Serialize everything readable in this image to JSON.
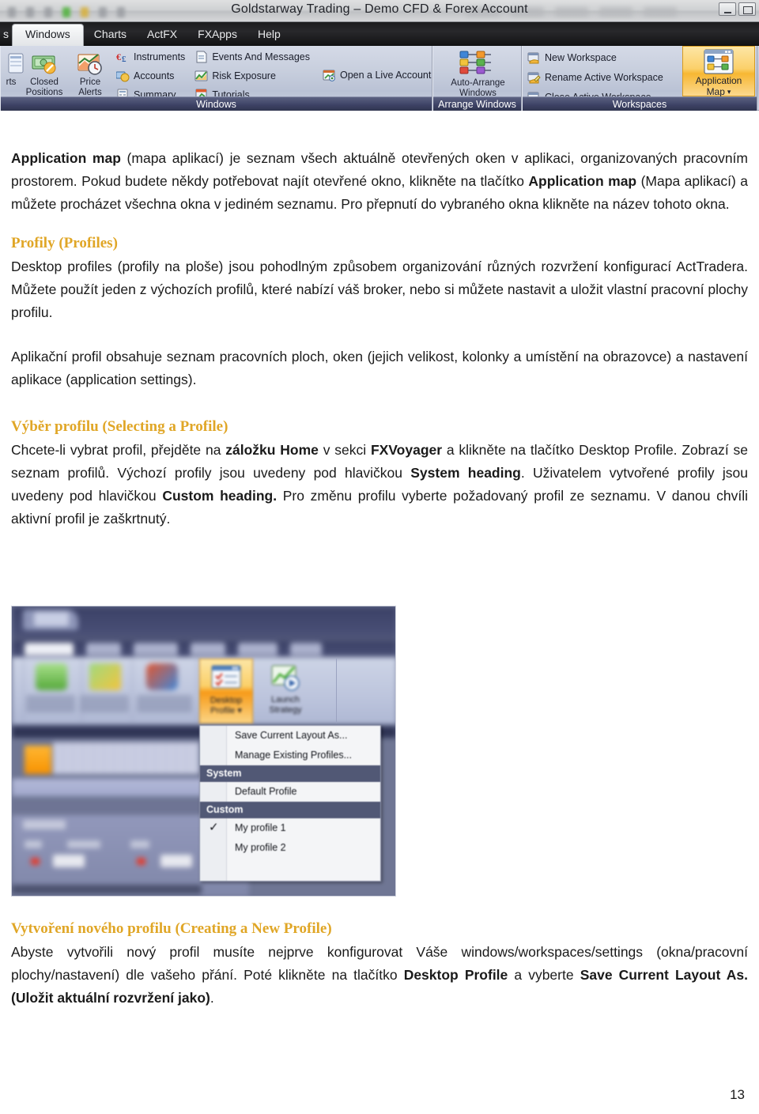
{
  "ribbon_screenshot": {
    "window_title": "Goldstarway Trading – Demo CFD & Forex Account",
    "window_buttons": [
      "minimize-button",
      "restore-button"
    ],
    "tabs": [
      {
        "label": "s",
        "active": false,
        "clipped": true
      },
      {
        "label": "Windows",
        "active": true
      },
      {
        "label": "Charts",
        "active": false
      },
      {
        "label": "ActFX",
        "active": false
      },
      {
        "label": "FXApps",
        "active": false
      },
      {
        "label": "Help",
        "active": false
      }
    ],
    "groups": [
      {
        "name": "Windows",
        "label": "Windows",
        "big_buttons": [
          {
            "line1": "rts",
            "line2": "",
            "icon": "clipped-icon"
          },
          {
            "line1": "Closed",
            "line2": "Positions",
            "icon": "money-icon"
          },
          {
            "line1": "Price",
            "line2": "Alerts",
            "icon": "price-alert-icon"
          }
        ],
        "small_items_col1": [
          {
            "label": "Instruments",
            "icon": "currency-icon"
          },
          {
            "label": "Accounts",
            "icon": "accounts-icon"
          },
          {
            "label": "Summary",
            "icon": "summary-icon"
          }
        ],
        "small_items_col2": [
          {
            "label": "Events And Messages",
            "icon": "events-icon"
          },
          {
            "label": "Risk Exposure",
            "icon": "risk-chart-icon"
          },
          {
            "label": "Tutorials",
            "icon": "tutorials-icon"
          }
        ],
        "small_items_col3": [
          {
            "label": "Open a Live Account",
            "icon": "live-account-icon"
          }
        ]
      },
      {
        "name": "Arrange Windows",
        "label": "Arrange Windows",
        "big_buttons": [
          {
            "line1": "Auto-Arrange",
            "line2": "Windows",
            "icon": "auto-arrange-icon"
          }
        ]
      },
      {
        "name": "Workspaces",
        "label": "Workspaces",
        "small_items_col1": [
          {
            "label": "New Workspace",
            "icon": "new-workspace-icon"
          },
          {
            "label": "Rename Active Workspace",
            "icon": "rename-workspace-icon"
          },
          {
            "label": "Close Active Workspace",
            "icon": "close-workspace-icon"
          }
        ],
        "highlight_button": {
          "line1": "Application",
          "line2": "Map",
          "dropdown_caret": "▾",
          "icon": "application-map-icon",
          "highlight_color": "#f7b733"
        }
      }
    ]
  },
  "document": {
    "paragraph_1": {
      "bold_1": "Application map",
      "text_1": " (mapa aplikací) je seznam všech aktuálně otevřených oken v aplikaci, organizovaných pracovním prostorem. Pokud budete někdy potřebovat najít otevřené okno, klikněte na tlačítko ",
      "bold_2": "Application map",
      "text_2": " (Mapa aplikací) a můžete procházet všechna okna v jediném seznamu. Pro přepnutí do vybraného okna klikněte na název tohoto okna."
    },
    "heading_1": "Profily (Profiles)",
    "paragraph_2": "Desktop profiles (profily na ploše) jsou pohodlným způsobem organizování různých rozvržení konfigurací ActTradera. Můžete použít jeden z výchozích profilů, které nabízí váš broker, nebo si můžete nastavit a uložit vlastní pracovní plochy profilu.",
    "paragraph_3": "Aplikační profil obsahuje seznam pracovních ploch, oken (jejich velikost, kolonky a umístění na obrazovce) a nastavení aplikace (application settings).",
    "heading_2": "Výběr profilu (Selecting a Profile)",
    "paragraph_4": {
      "text_1": "Chcete-li vybrat profil, přejděte na ",
      "bold_1": "záložku Home",
      "text_2": " v sekci ",
      "bold_2": "FXVoyager",
      "text_3": " a klikněte na tlačítko Desktop Profile. Zobrazí se seznam profilů. Výchozí profily jsou uvedeny pod hlavičkou ",
      "bold_3": "System heading",
      "text_4": ". Uživatelem vytvořené profily jsou uvedeny pod hlavičkou ",
      "bold_4": "Custom heading.",
      "text_5": " Pro změnu profilu vyberte požadovaný profil ze seznamu. V danou chvíli aktivní profil je zaškrtnutý."
    },
    "heading_3": "Vytvoření nového profilu (Creating a New Profile)",
    "paragraph_5": {
      "text_1": "Abyste vytvořili nový profil musíte nejprve konfigurovat Váše windows/workspaces/settings (okna/pracovní plochy/nastavení) dle vašeho přání. Poté klikněte na tlačítko ",
      "bold_1": "Desktop Profile",
      "text_2": " a vyberte ",
      "bold_2": "Save Current Layout As. (Uložit aktuální rozvržení jako)",
      "text_3": "."
    },
    "heading_color": "#e0a626",
    "page_number": "13"
  },
  "profile_screenshot": {
    "ribbon_buttons": [
      {
        "line1": "Desktop",
        "line2": "Profile",
        "caret": "▾",
        "highlighted": true
      },
      {
        "line1": "Launch",
        "line2": "Strategy",
        "highlighted": false
      }
    ],
    "menu": {
      "items": [
        {
          "label": "Save Current Layout As...",
          "type": "item",
          "checked": false
        },
        {
          "label": "Manage Existing Profiles...",
          "type": "item",
          "checked": false
        },
        {
          "label": "System",
          "type": "header"
        },
        {
          "label": "Default Profile",
          "type": "item",
          "checked": false
        },
        {
          "label": "Custom",
          "type": "header"
        },
        {
          "label": "My profile 1",
          "type": "item",
          "checked": true
        },
        {
          "label": "My profile 2",
          "type": "item",
          "checked": false
        }
      ],
      "check_glyph": "✓",
      "header_bg": "#515875"
    }
  }
}
